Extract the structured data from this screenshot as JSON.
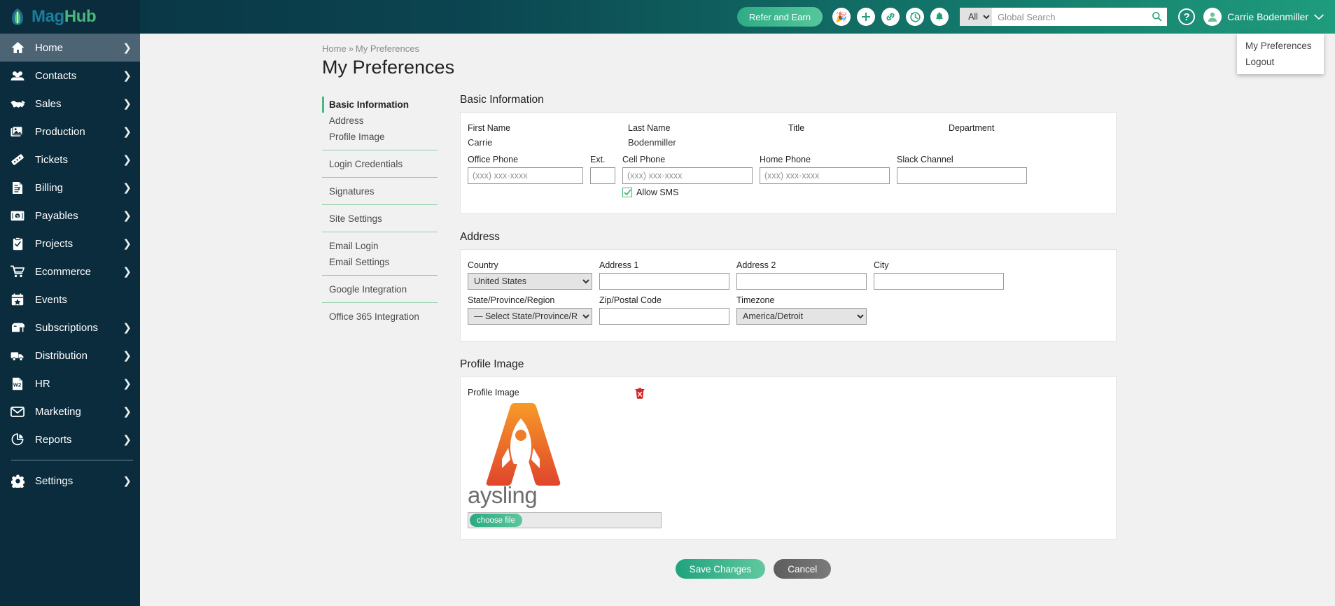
{
  "brand": {
    "name_part1": "Mag",
    "name_part2": "Hub",
    "logo_icon": "maghub-mark-icon"
  },
  "header": {
    "refer_label": "Refer and Earn",
    "icons": [
      {
        "name": "party-popper-icon",
        "glyph": "🎉"
      },
      {
        "name": "plus-icon",
        "glyph": "+"
      },
      {
        "name": "link-icon",
        "glyph": "🔗"
      },
      {
        "name": "history-clock-icon",
        "glyph": "↺"
      },
      {
        "name": "bell-icon",
        "glyph": "🔔"
      }
    ],
    "search": {
      "scope": "All",
      "placeholder": "Global Search",
      "value": "",
      "icon": "search-icon"
    },
    "help_label": "?",
    "user": {
      "name": "Carrie Bodenmiller",
      "caret": "⌄",
      "avatar_icon": "user-avatar-icon"
    },
    "user_menu": {
      "items": [
        "My Preferences",
        "Logout"
      ]
    },
    "colors": {
      "gradient_start": "#0a3142",
      "gradient_end": "#1f9c7d",
      "accent_green": "#25a07e"
    }
  },
  "sidebar": {
    "items": [
      {
        "label": "Home",
        "icon": "home-icon",
        "chevron": "❯",
        "active": true
      },
      {
        "label": "Contacts",
        "icon": "contacts-icon",
        "chevron": "❯",
        "active": false
      },
      {
        "label": "Sales",
        "icon": "handshake-icon",
        "chevron": "❯",
        "active": false
      },
      {
        "label": "Production",
        "icon": "production-icon",
        "chevron": "❯",
        "active": false
      },
      {
        "label": "Tickets",
        "icon": "ticket-icon",
        "chevron": "❯",
        "active": false
      },
      {
        "label": "Billing",
        "icon": "invoice-icon",
        "chevron": "❯",
        "active": false
      },
      {
        "label": "Payables",
        "icon": "money-icon",
        "chevron": "❯",
        "active": false
      },
      {
        "label": "Projects",
        "icon": "clipboard-icon",
        "chevron": "❯",
        "active": false
      },
      {
        "label": "Ecommerce",
        "icon": "cart-icon",
        "chevron": "❯",
        "active": false
      },
      {
        "label": "Events",
        "icon": "calendar-star-icon",
        "chevron": "",
        "active": false
      },
      {
        "label": "Subscriptions",
        "icon": "mailbox-icon",
        "chevron": "❯",
        "active": false
      },
      {
        "label": "Distribution",
        "icon": "truck-icon",
        "chevron": "❯",
        "active": false
      },
      {
        "label": "HR",
        "icon": "w2-document-icon",
        "chevron": "❯",
        "active": false
      },
      {
        "label": "Marketing",
        "icon": "envelope-icon",
        "chevron": "❯",
        "active": false
      },
      {
        "label": "Reports",
        "icon": "pie-chart-icon",
        "chevron": "❯",
        "active": false
      }
    ],
    "footer_items": [
      {
        "label": "Settings",
        "icon": "gear-icon",
        "chevron": "❯"
      }
    ]
  },
  "breadcrumb": {
    "home": "Home",
    "separator": "»",
    "current": "My Preferences"
  },
  "page": {
    "title": "My Preferences"
  },
  "subnav": {
    "groups": [
      {
        "items": [
          {
            "label": "Basic Information",
            "active": true
          },
          {
            "label": "Address",
            "active": false
          },
          {
            "label": "Profile Image",
            "active": false
          }
        ]
      },
      {
        "items": [
          {
            "label": "Login Credentials",
            "active": false
          }
        ]
      },
      {
        "items": [
          {
            "label": "Signatures",
            "active": false
          }
        ]
      },
      {
        "items": [
          {
            "label": "Site Settings",
            "active": false
          }
        ]
      },
      {
        "items": [
          {
            "label": "Email Login",
            "active": false
          },
          {
            "label": "Email Settings",
            "active": false
          }
        ]
      },
      {
        "items": [
          {
            "label": "Google Integration",
            "active": false
          }
        ]
      },
      {
        "items": [
          {
            "label": "Office 365 Integration",
            "active": false
          }
        ]
      }
    ]
  },
  "basic_information": {
    "title": "Basic Information",
    "first_name": {
      "label": "First Name",
      "value": "Carrie"
    },
    "last_name": {
      "label": "Last Name",
      "value": "Bodenmiller"
    },
    "title_field": {
      "label": "Title",
      "value": ""
    },
    "department": {
      "label": "Department",
      "value": ""
    },
    "office_phone": {
      "label": "Office Phone",
      "placeholder": "(xxx) xxx-xxxx",
      "value": ""
    },
    "ext": {
      "label": "Ext.",
      "placeholder": "",
      "value": ""
    },
    "cell_phone": {
      "label": "Cell Phone",
      "placeholder": "(xxx) xxx-xxxx",
      "value": ""
    },
    "home_phone": {
      "label": "Home Phone",
      "placeholder": "(xxx) xxx-xxxx",
      "value": ""
    },
    "slack_channel": {
      "label": "Slack Channel",
      "placeholder": "",
      "value": ""
    },
    "allow_sms": {
      "label": "Allow SMS",
      "checked": true
    }
  },
  "address": {
    "title": "Address",
    "country": {
      "label": "Country",
      "value": "United States"
    },
    "address1": {
      "label": "Address 1",
      "value": ""
    },
    "address2": {
      "label": "Address 2",
      "value": ""
    },
    "city": {
      "label": "City",
      "value": ""
    },
    "state": {
      "label": "State/Province/Region",
      "value": "— Select State/Province/Region"
    },
    "zip": {
      "label": "Zip/Postal Code",
      "value": ""
    },
    "timezone": {
      "label": "Timezone",
      "value": "America/Detroit"
    }
  },
  "profile_image": {
    "title": "Profile Image",
    "field_label": "Profile Image",
    "delete_icon": "trash-delete-icon",
    "logo_word": "aysling",
    "logo_colors": {
      "top": "#f79a28",
      "bottom": "#e0452c",
      "word": "#6e6e6e"
    },
    "choose_file_label": "choose file",
    "file_value": ""
  },
  "footer": {
    "save_label": "Save Changes",
    "cancel_label": "Cancel"
  }
}
